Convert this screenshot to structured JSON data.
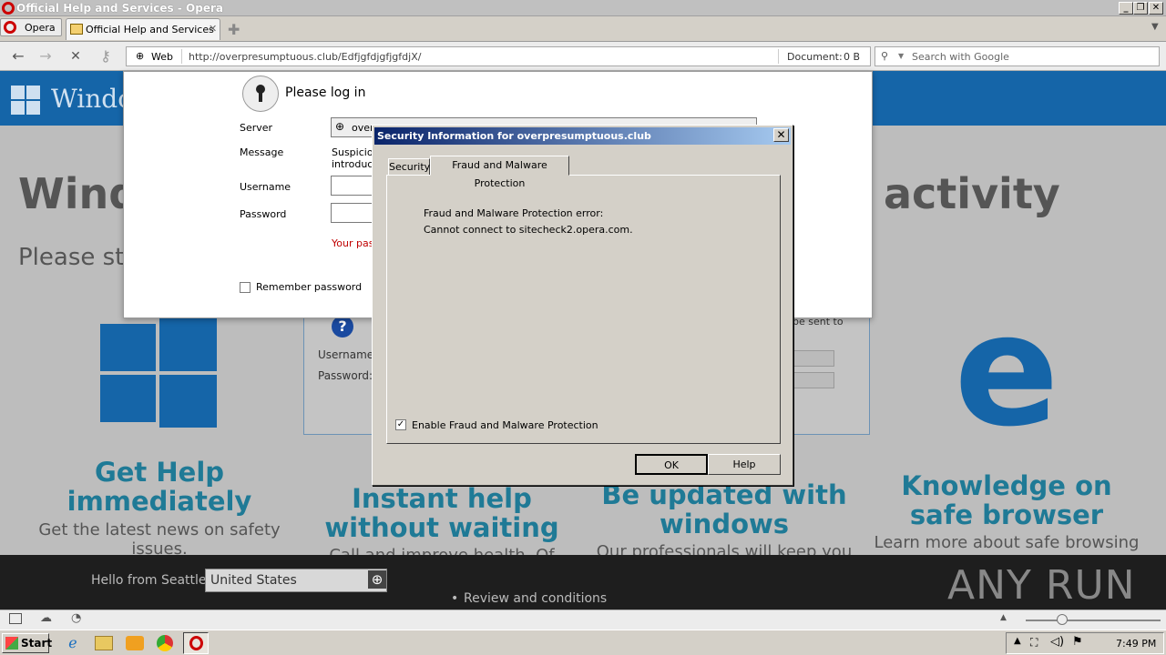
{
  "window": {
    "title": "Official Help and Services - Opera"
  },
  "menu": {
    "label": "Opera"
  },
  "tabs": [
    {
      "label": "Official Help and Services"
    }
  ],
  "address": {
    "mode": "Web",
    "url": "http://overpresumptuous.club/EdfjgfdjgfjgfdjX/",
    "doc_label": "Document:",
    "doc_size": "0 B"
  },
  "search": {
    "placeholder": "Search with Google"
  },
  "page": {
    "brand": "Windo",
    "headline_left": "Windo",
    "headline_right": "activity",
    "subhead": "Please st",
    "features": [
      {
        "title": "Get Help immediately",
        "text": "Get the latest news on safety issues."
      },
      {
        "title": "Instant help without waiting",
        "text": "Call and improve health. Of your"
      },
      {
        "title": "Be updated with windows",
        "text": "Our professionals will keep you"
      },
      {
        "title": "Knowledge on safe browser",
        "text": "Learn more about safe browsing"
      }
    ],
    "bg_form": {
      "username_label": "Username",
      "password_label": "Password:",
      "sent_text": "be sent to"
    },
    "footer": {
      "hello": "Hello from Seattle",
      "country": "United States",
      "link1": "Review and conditions"
    }
  },
  "login": {
    "title": "Please log in",
    "server_label": "Server",
    "server_value": "over",
    "message_label": "Message",
    "message_text": "Suspiciou introduce",
    "username_label": "Username",
    "password_label": "Password",
    "error_text": "Your pass",
    "remember_label": "Remember password"
  },
  "dialog": {
    "title": "Security Information for overpresumptuous.club",
    "tabs": [
      "Security",
      "Fraud and Malware Protection"
    ],
    "line1": "Fraud and Malware Protection error:",
    "line2": "Cannot connect to sitecheck2.opera.com.",
    "checkbox_label": "Enable Fraud and Malware Protection",
    "checkbox_checked": true,
    "ok": "OK",
    "help": "Help"
  },
  "taskbar": {
    "start": "Start",
    "time": "7:49 PM"
  },
  "watermark": "ANY RUN",
  "colors": {
    "banner": "#1565a8",
    "feature_title": "#1f7a96",
    "dialog_title": "#0a246a",
    "error": "#c00000"
  }
}
